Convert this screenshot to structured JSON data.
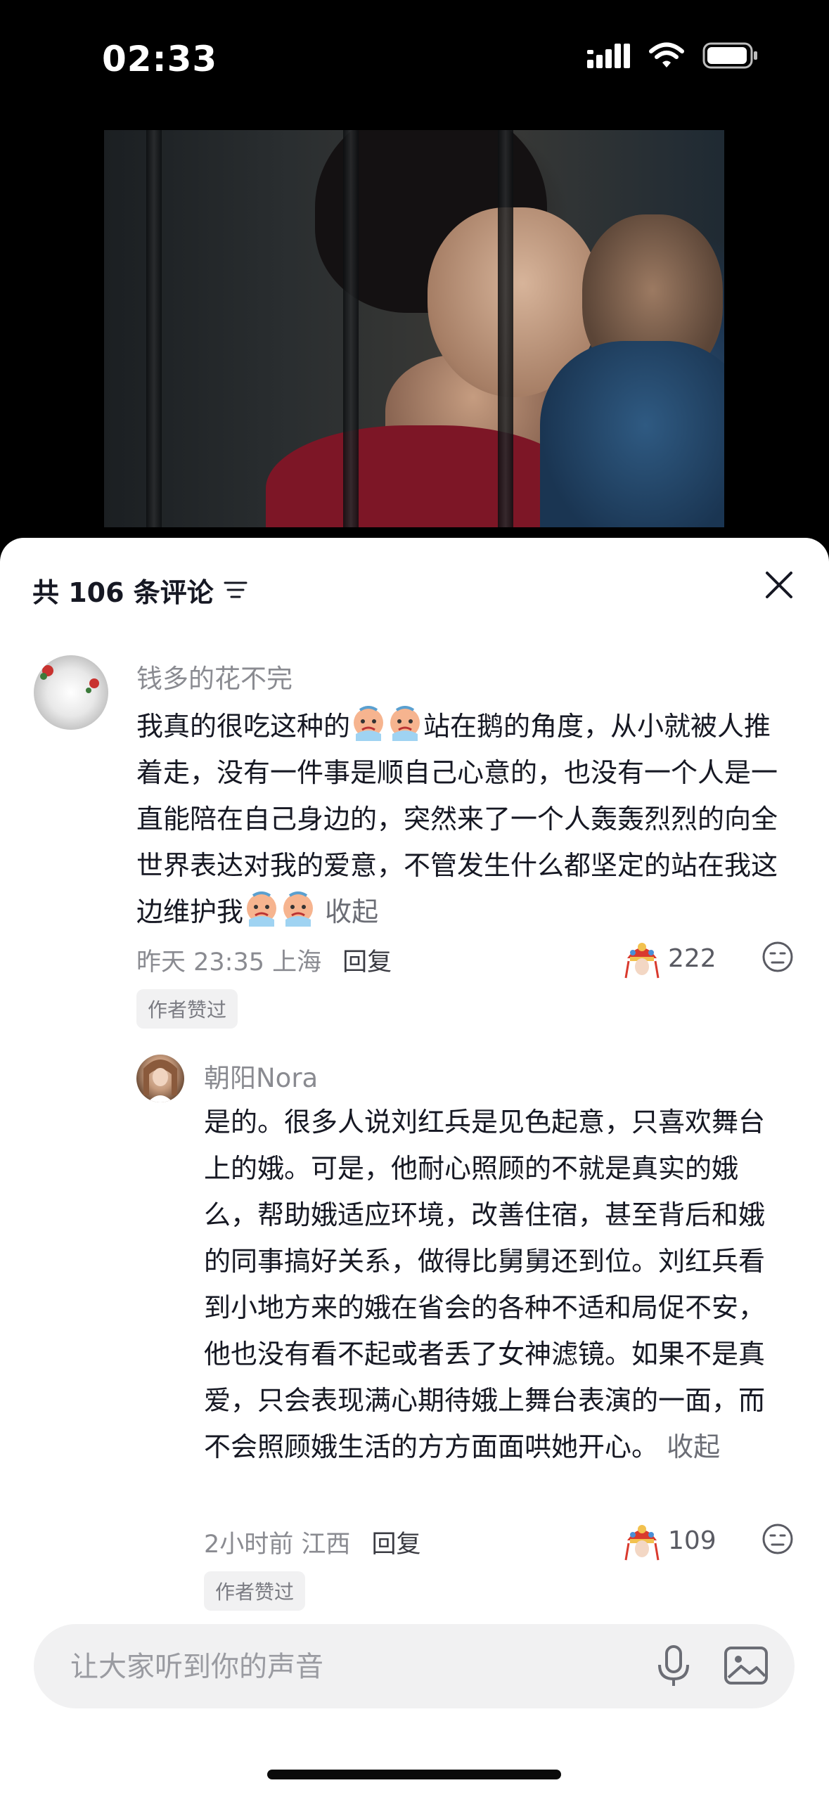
{
  "status_bar": {
    "time": "02:33",
    "battery_level": 0.85
  },
  "video": {
    "description_icon": "video-frame"
  },
  "comments_header": {
    "title": "共 106 条评论"
  },
  "comments": [
    {
      "username": "钱多的花不完",
      "text_part1": "我真的很吃这种的",
      "text_part2": "站在鹅的角度，从小就被人推着走，没有一件事是顺自己心意的，也没有一个人是一直能陪在自己身边的，突然来了一个人轰轰烈烈的向全世界表达对我的爱意，不管发生什么都坚定的站在我这边维护我",
      "collapse_label": "收起",
      "time": "昨天 23:35",
      "location": "上海",
      "reply_label": "回复",
      "likes": "222",
      "author_badge": "作者赞过"
    },
    {
      "username": "朝阳Nora",
      "text": "是的。很多人说刘红兵是见色起意，只喜欢舞台上的娥。可是，他耐心照顾的不就是真实的娥么，帮助娥适应环境，改善住宿，甚至背后和娥的同事搞好关系，做得比舅舅还到位。刘红兵看到小地方来的娥在省会的各种不适和局促不安，他也没有看不起或者丢了女神滤镜。如果不是真爱，只会表现满心期待娥上舞台表演的一面，而不会照顾娥生活的方方面面哄她开心。",
      "collapse_label": "收起",
      "time": "2小时前",
      "location": "江西",
      "reply_label": "回复",
      "likes": "109",
      "author_badge": "作者赞过"
    }
  ],
  "input": {
    "placeholder": "让大家听到你的声音"
  }
}
